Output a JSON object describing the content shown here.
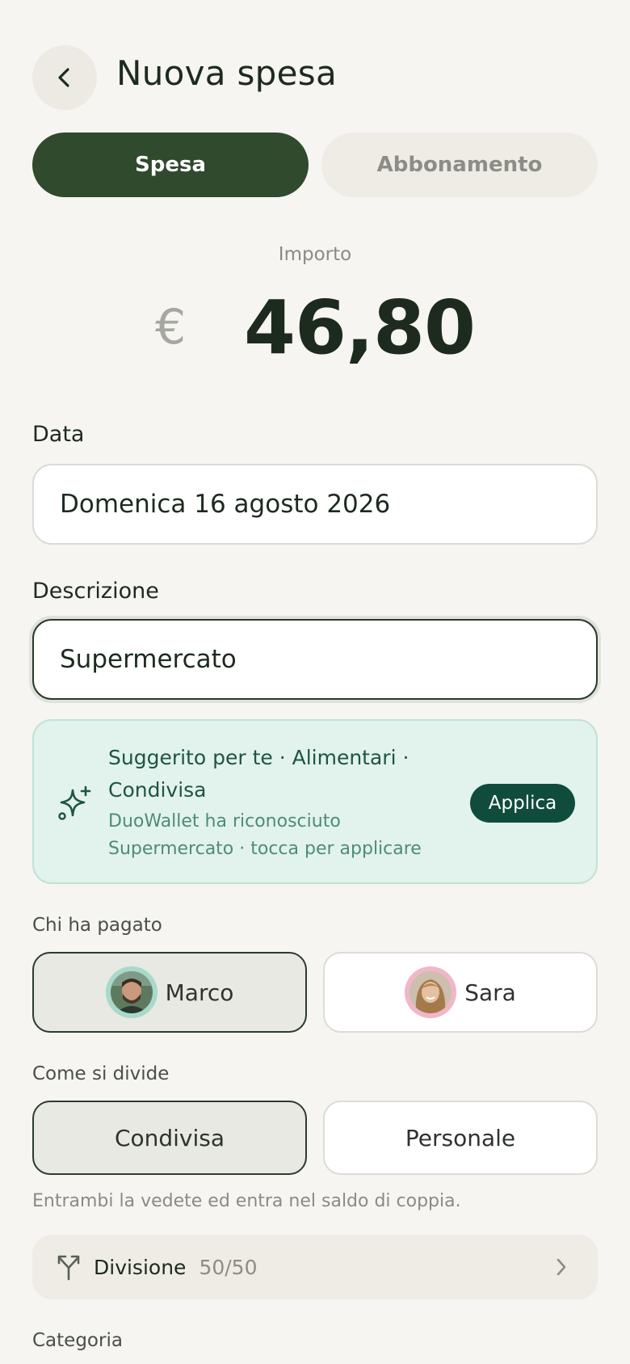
{
  "header": {
    "title": "Nuova spesa",
    "back_icon": "chevron-left-icon"
  },
  "type_toggle": {
    "options": [
      "Spesa",
      "Abbonamento"
    ],
    "selected": "Spesa"
  },
  "amount": {
    "label": "Importo",
    "currency": "€",
    "value": "46,80"
  },
  "date": {
    "label": "Data",
    "value": "Domenica 16 agosto 2026"
  },
  "description": {
    "label": "Descrizione",
    "value": "Supermercato"
  },
  "suggestion": {
    "icon": "sparkle-icon",
    "title": "Suggerito per te · Alimentari · Condivisa",
    "subtitle": "DuoWallet ha riconosciuto Supermercato · tocca per applicare",
    "apply_label": "Applica"
  },
  "payer": {
    "label": "Chi ha pagato",
    "options": [
      {
        "name": "Marco",
        "ring_color": "#a8d9cb"
      },
      {
        "name": "Sara",
        "ring_color": "#f0b7c8"
      }
    ],
    "selected": "Marco"
  },
  "split_mode": {
    "label": "Come si divide",
    "options": [
      "Condivisa",
      "Personale"
    ],
    "selected": "Condivisa",
    "hint": "Entrambi la vedete ed entra nel saldo di coppia."
  },
  "division": {
    "icon": "split-icon",
    "label": "Divisione",
    "value": "50/50",
    "chevron_icon": "chevron-right-icon"
  },
  "category": {
    "label": "Categoria"
  },
  "colors": {
    "primary": "#2f4a2d",
    "suggest_bg": "#e1f3ec",
    "apply_bg": "#0f4c3b"
  }
}
